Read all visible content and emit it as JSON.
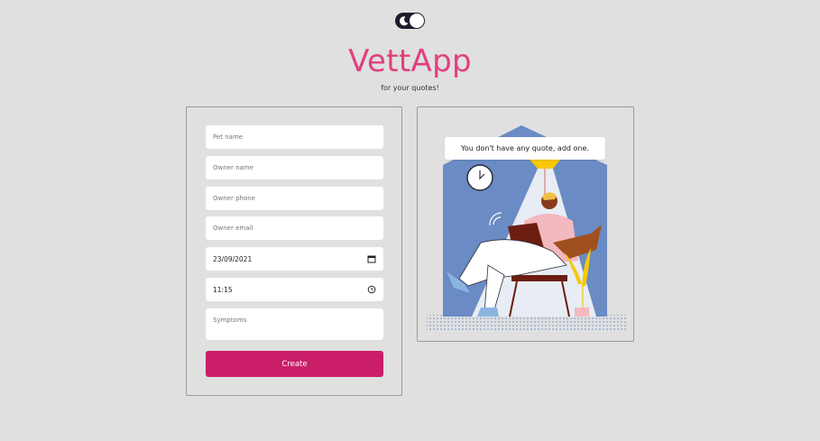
{
  "header": {
    "title": "VettApp",
    "subtitle": "for your quotes!"
  },
  "theme_toggle": {
    "mode": "dark-mode-toggle",
    "icon": "moon-icon"
  },
  "form": {
    "pet_name_placeholder": "Pet name",
    "owner_name_placeholder": "Owner name",
    "owner_phone_placeholder": "Owner phone",
    "owner_email_placeholder": "Owner email",
    "date_value": "23/09/2021",
    "time_value": "11:15",
    "symptoms_placeholder": "Symptoms",
    "create_label": "Create",
    "icons": {
      "date": "calendar-icon",
      "time": "clock-icon"
    }
  },
  "quotes_panel": {
    "empty_message": "You don't have any quote, add one."
  },
  "colors": {
    "accent": "#e0407e",
    "button": "#ca1e68",
    "background": "#e0e0e0",
    "illustration_blue": "#6a8bc4"
  }
}
